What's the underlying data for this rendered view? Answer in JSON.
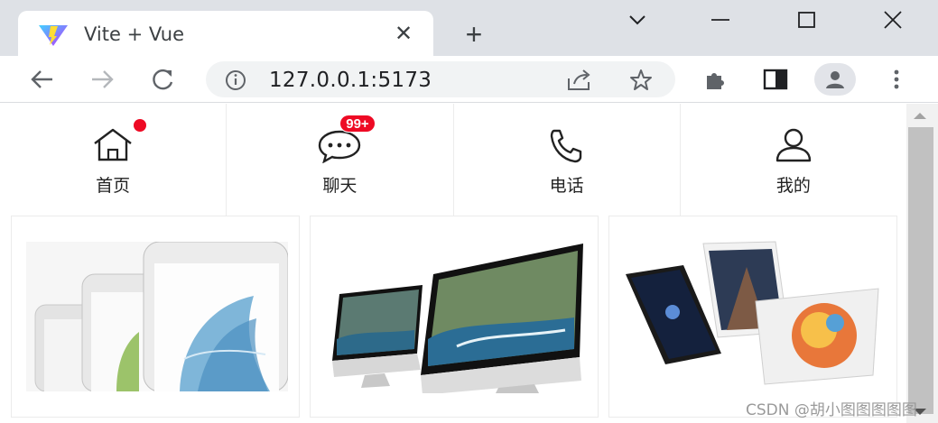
{
  "browser": {
    "tab_title": "Vite + Vue",
    "tab_close_glyph": "✕",
    "newtab_glyph": "+",
    "url": "127.0.0.1:5173",
    "icons": [
      "minimize-icon",
      "maximize-icon",
      "close-window-icon",
      "tab-list-icon",
      "back-icon",
      "forward-icon",
      "reload-icon",
      "site-info-icon",
      "share-icon",
      "bookmark-star-icon",
      "extensions-icon",
      "side-panel-icon",
      "profile-icon",
      "menu-icon"
    ]
  },
  "nav": {
    "items": [
      {
        "label": "首页",
        "icon": "home-icon",
        "dot": true
      },
      {
        "label": "聊天",
        "icon": "chat-icon",
        "badge": "99+"
      },
      {
        "label": "电话",
        "icon": "phone-icon"
      },
      {
        "label": "我的",
        "icon": "user-icon"
      }
    ]
  },
  "products": [
    {
      "name": "iphone-image"
    },
    {
      "name": "imac-image"
    },
    {
      "name": "ipad-image"
    }
  ],
  "colors": {
    "accent_red": "#ee0a24",
    "tabstrip": "#dee1e6"
  },
  "watermark": "CSDN @胡小图图图图图"
}
